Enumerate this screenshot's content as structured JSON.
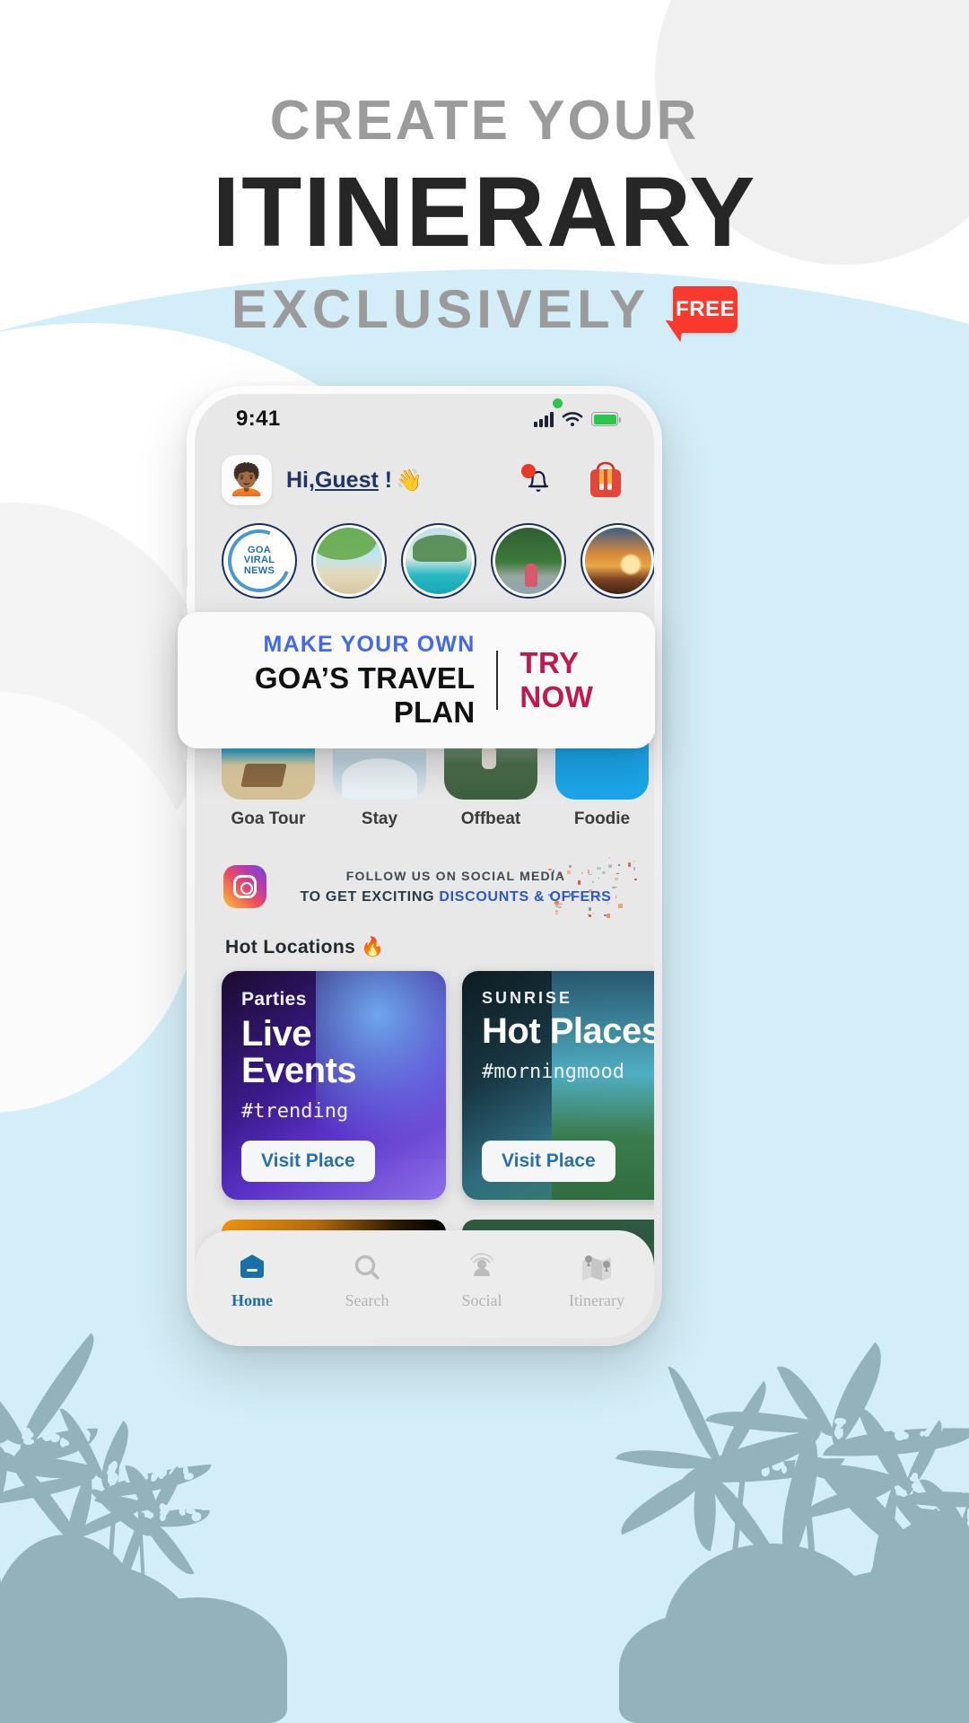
{
  "headline": {
    "line1": "CREATE YOUR",
    "line2": "ITINERARY",
    "line3": "EXCLUSIVELY",
    "badge": "FREE",
    "badge_color": "#f9392e",
    "line1_color": "#9b9b9b",
    "line2_color": "#262626"
  },
  "phone": {
    "status_bar": {
      "time": "9:41",
      "signal_icon": "signal-bars-icon",
      "wifi_icon": "wifi-icon",
      "battery_icon": "battery-icon",
      "recording_dot": "green-dot-indicator"
    },
    "header": {
      "avatar_icon": "avatar-emoji",
      "greeting_prefix": "Hi,",
      "greeting_name": "Guest",
      "greeting_suffix": "!",
      "wave_icon": "waving-hand-emoji",
      "notification_icon": "bell-icon",
      "notification_badge": true,
      "bag_icon": "backpack-icon",
      "greeting_color": "#1f3464"
    },
    "stories": [
      {
        "label": "GOA VIRAL NEWS",
        "type": "logo",
        "line1": "GOA",
        "line2": "VIRAL",
        "line3": "NEWS"
      },
      {
        "label": "Beach",
        "type": "photo"
      },
      {
        "label": "Resort Pool",
        "type": "photo"
      },
      {
        "label": "Jungle",
        "type": "photo"
      },
      {
        "label": "Sunset Beach",
        "type": "photo"
      }
    ],
    "categories": [
      {
        "label": "Goa Tour"
      },
      {
        "label": "Stay"
      },
      {
        "label": "Offbeat"
      },
      {
        "label": "Foodie"
      }
    ],
    "social": {
      "icon": "instagram-icon",
      "line1": "FOLLOW US ON SOCIAL MEDIA",
      "line2_plain": "TO GET EXCITING ",
      "line2_highlight": "DISCOUNTS & OFFERS",
      "highlight_color": "#2b58c9"
    },
    "hot_locations": {
      "title": "Hot Locations 🔥",
      "cards": [
        {
          "kicker": "Parties",
          "title": "Live Events",
          "tag": "#trending",
          "button": "Visit Place"
        },
        {
          "kicker": "SUNRISE",
          "title": "Hot Places",
          "tag": "#morningmood",
          "button": "Visit Place"
        }
      ]
    },
    "bottom_nav": [
      {
        "label": "Home",
        "icon": "home-icon",
        "active": true
      },
      {
        "label": "Search",
        "icon": "search-icon",
        "active": false
      },
      {
        "label": "Social",
        "icon": "social-icon",
        "active": false
      },
      {
        "label": "Itinerary",
        "icon": "map-icon",
        "active": false
      }
    ],
    "nav_active_color": "#1b6fa8"
  },
  "overlay_card": {
    "line1": "MAKE YOUR OWN",
    "line2": "GOA’S TRAVEL PLAN",
    "cta": "TRY NOW",
    "line1_color": "#4169e8",
    "cta_color": "#c2184b"
  },
  "background": {
    "sky_color": "#d3eef8",
    "circle_color": "#f0f0f0",
    "palm_color": "#6f8f96"
  }
}
